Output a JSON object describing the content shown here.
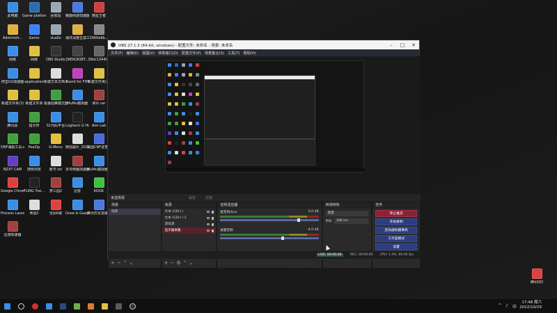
{
  "desktop": {
    "icons": [
      {
        "label": "此电脑",
        "color": "#3a8ee6"
      },
      {
        "label": "Game platform",
        "color": "#2b6cb0"
      },
      {
        "label": "回收站",
        "color": "#9aa7b5"
      },
      {
        "label": "螺旋网游加速器",
        "color": "#4a7adf"
      },
      {
        "label": "微星王者",
        "color": "#d04040"
      },
      {
        "label": "Administr...",
        "color": "#e0b040"
      },
      {
        "label": "Game",
        "color": "#3b82f6"
      },
      {
        "label": "studio",
        "color": "#9aa7b5"
      },
      {
        "label": "海洋深度生成工具...(5).exe",
        "color": "#e0b040"
      },
      {
        "label": "2900e6b...",
        "color": "#888"
      },
      {
        "label": "网络",
        "color": "#3a8ee6"
      },
      {
        "label": "网络",
        "color": "#e0c040"
      },
      {
        "label": "OBS Studio",
        "color": "#333"
      },
      {
        "label": "[NER(9QBT...",
        "color": "#444"
      },
      {
        "label": "38dc1344f...",
        "color": "#666"
      },
      {
        "label": "阿里UU加速器",
        "color": "#3a8ee6"
      },
      {
        "label": "application",
        "color": "#e0c040"
      },
      {
        "label": "新建文本文档.txt",
        "color": "#ddd"
      },
      {
        "label": "Stand for FH5.exe",
        "color": "#c040c0"
      },
      {
        "label": "新建文件夹(2)",
        "color": "#e0c040"
      },
      {
        "label": "新建文件夹(3)",
        "color": "#e0c040"
      },
      {
        "label": "新建文件夹",
        "color": "#e0c040"
      },
      {
        "label": "极速巡察模式器",
        "color": "#40a040"
      },
      {
        "label": "MuMu模拟器",
        "color": "#3a8ee6"
      },
      {
        "label": "照片.rar",
        "color": "#a04040"
      },
      {
        "label": "腾讯会",
        "color": "#3a8ee6"
      },
      {
        "label": "猎犬传",
        "color": "#40a040"
      },
      {
        "label": "51代码平台",
        "color": "#3a8ee6"
      },
      {
        "label": "Logitech G HUB",
        "color": "#222"
      },
      {
        "label": "Aim Lab",
        "color": "#3a8ee6"
      },
      {
        "label": "DNF海报工具.exe",
        "color": "#40a040"
      },
      {
        "label": "PeaZip",
        "color": "#40a040"
      },
      {
        "label": "G-Menu",
        "color": "#e0c040"
      },
      {
        "label": "微信图片_2022072...",
        "color": "#ddd"
      },
      {
        "label": "我国CNF证查确(含)",
        "color": "#4a6ae0"
      },
      {
        "label": "NZXT CAM",
        "color": "#6040c0"
      },
      {
        "label": "搜狗浏览",
        "color": "#3a8ee6"
      },
      {
        "label": "账号.txt",
        "color": "#ddd"
      },
      {
        "label": "多项电脑加速器",
        "color": "#a04040"
      },
      {
        "label": "MuMu模拟器12",
        "color": "#3a8ee6"
      },
      {
        "label": "Google Chrome",
        "color": "#e04040"
      },
      {
        "label": "FLING Trai...",
        "color": "#222"
      },
      {
        "label": "梦三国2",
        "color": "#a04040"
      },
      {
        "label": "迅雷",
        "color": "#3a8ee6"
      },
      {
        "label": "KOOK",
        "color": "#40c040"
      },
      {
        "label": "Process Lasso",
        "color": "#3a8ee6"
      },
      {
        "label": "命运2",
        "color": "#ddd"
      },
      {
        "label": "全民K歌",
        "color": "#e04040"
      },
      {
        "label": "Draw & Guess",
        "color": "#3a8ee6"
      },
      {
        "label": "腾讯优化加速器",
        "color": "#4a7adf"
      },
      {
        "label": "迅游加速器",
        "color": "#a04040"
      }
    ],
    "right_icon": {
      "label": "腾讯QQ",
      "color": "#e04040"
    }
  },
  "obs": {
    "title": "OBS 27.1.3 (64-bit, windows) - 配置文件: 未命名 - 场景: 未命名",
    "menu": [
      "文件(F)",
      "编辑(E)",
      "视图(V)",
      "停靠窗口(D)",
      "配置文件(P)",
      "场景集合(S)",
      "工具(T)",
      "帮助(H)"
    ],
    "strip_left": "未选择源",
    "strip_props": "属性",
    "strip_filters": "滤镜",
    "scenes": {
      "header": "场景",
      "items": [
        "场景"
      ]
    },
    "sources": {
      "header": "来源",
      "items": [
        "文本 (GDI+)",
        "文本 (GDI+) 2",
        "游戏源",
        "显示器采集"
      ]
    },
    "mixer": {
      "header": "音频混音器",
      "channels": [
        {
          "name": "麦克风/Aux",
          "db": "0.0 dB"
        },
        {
          "name": "桌面音频",
          "db": "-4.0 dB"
        }
      ]
    },
    "transitions": {
      "header": "转场特效",
      "selected": "渐变",
      "duration_label": "时长",
      "duration": "300 ms"
    },
    "controls": {
      "header": "控件",
      "buttons": [
        "停止推流",
        "开始录制",
        "启动虚拟摄像机",
        "工作室模式",
        "设置",
        "退出"
      ]
    },
    "status": {
      "live": "LIVE: 00:00:00",
      "rec": "REC: 00:00:00",
      "cpu": "CPU: 1.2%, 60.00 fps"
    }
  },
  "taskbar": {
    "time": "17:48 周六",
    "date": "2022/10/29",
    "tray_text": "中"
  }
}
